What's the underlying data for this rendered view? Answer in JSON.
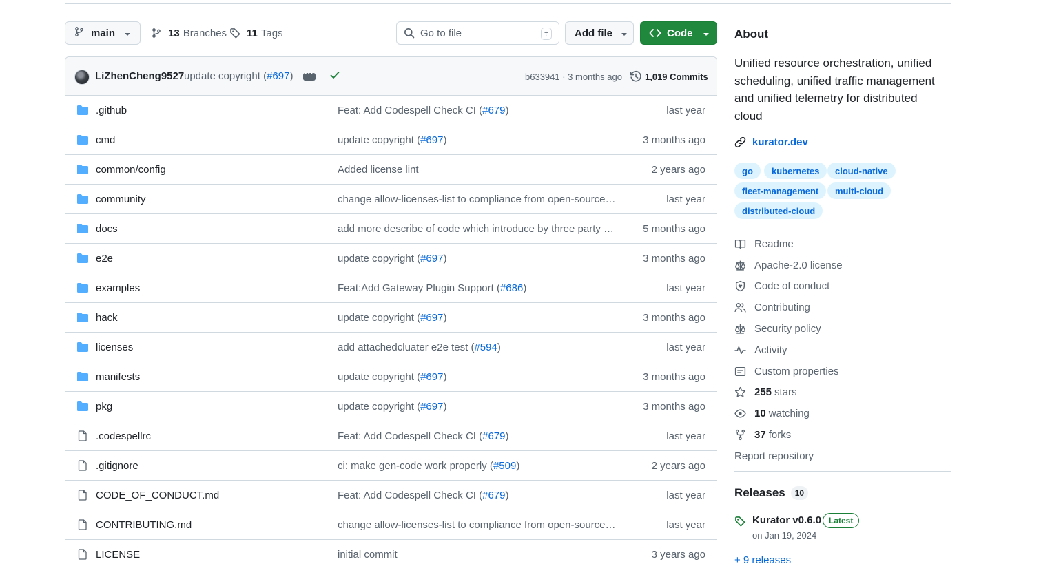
{
  "toolbar": {
    "branch": "main",
    "branches_count": "13",
    "branches_label": "Branches",
    "tags_count": "11",
    "tags_label": "Tags",
    "search_placeholder": "Go to file",
    "search_kbd": "t",
    "add_file": "Add file",
    "code": "Code"
  },
  "commit": {
    "author": "LiZhenCheng9527",
    "message": "update copyright (",
    "pr": "#697",
    "message_end": ")",
    "sha_age": "b633941 · 3 months ago",
    "commits": "1,019 Commits"
  },
  "files": [
    {
      "type": "dir",
      "name": ".github",
      "msg": "Feat: Add Codespell Check CI (",
      "pr": "#679",
      "end": ")",
      "age": "last year"
    },
    {
      "type": "dir",
      "name": "cmd",
      "msg": "update copyright (",
      "pr": "#697",
      "end": ")",
      "age": "3 months ago"
    },
    {
      "type": "dir",
      "name": "common/config",
      "msg": "Added license lint",
      "pr": "",
      "end": "",
      "age": "2 years ago"
    },
    {
      "type": "dir",
      "name": "community",
      "msg": "change allow-licenses-list to compliance from open-source-…",
      "pr": "",
      "end": "",
      "age": "last year"
    },
    {
      "type": "dir",
      "name": "docs",
      "msg": "add more describe of code which introduce by three party o…",
      "pr": "",
      "end": "",
      "age": "5 months ago"
    },
    {
      "type": "dir",
      "name": "e2e",
      "msg": "update copyright (",
      "pr": "#697",
      "end": ")",
      "age": "3 months ago"
    },
    {
      "type": "dir",
      "name": "examples",
      "msg": "Feat:Add Gateway Plugin Support (",
      "pr": "#686",
      "end": ")",
      "age": "last year"
    },
    {
      "type": "dir",
      "name": "hack",
      "msg": "update copyright (",
      "pr": "#697",
      "end": ")",
      "age": "3 months ago"
    },
    {
      "type": "dir",
      "name": "licenses",
      "msg": "add attachedcluater e2e test (",
      "pr": "#594",
      "end": ")",
      "age": "last year"
    },
    {
      "type": "dir",
      "name": "manifests",
      "msg": "update copyright (",
      "pr": "#697",
      "end": ")",
      "age": "3 months ago"
    },
    {
      "type": "dir",
      "name": "pkg",
      "msg": "update copyright (",
      "pr": "#697",
      "end": ")",
      "age": "3 months ago"
    },
    {
      "type": "file",
      "name": ".codespellrc",
      "msg": "Feat: Add Codespell Check CI (",
      "pr": "#679",
      "end": ")",
      "age": "last year"
    },
    {
      "type": "file",
      "name": ".gitignore",
      "msg": "ci: make gen-code work properly (",
      "pr": "#509",
      "end": ")",
      "age": "2 years ago"
    },
    {
      "type": "file",
      "name": "CODE_OF_CONDUCT.md",
      "msg": "Feat: Add Codespell Check CI (",
      "pr": "#679",
      "end": ")",
      "age": "last year"
    },
    {
      "type": "file",
      "name": "CONTRIBUTING.md",
      "msg": "change allow-licenses-list to compliance from open-source-…",
      "pr": "",
      "end": "",
      "age": "last year"
    },
    {
      "type": "file",
      "name": "LICENSE",
      "msg": "initial commit",
      "pr": "",
      "end": "",
      "age": "3 years ago"
    }
  ],
  "about": {
    "heading": "About",
    "description": "Unified resource orchestration, unified scheduling, unified traffic management and unified telemetry for distributed cloud",
    "website": "kurator.dev",
    "topics": [
      "go",
      "kubernetes",
      "cloud-native",
      "fleet-management",
      "multi-cloud",
      "distributed-cloud"
    ],
    "meta": [
      {
        "icon": "book-icon",
        "count": "",
        "label": "Readme"
      },
      {
        "icon": "law-icon",
        "count": "",
        "label": "Apache-2.0 license"
      },
      {
        "icon": "heart-shield-icon",
        "count": "",
        "label": "Code of conduct"
      },
      {
        "icon": "people-icon",
        "count": "",
        "label": "Contributing"
      },
      {
        "icon": "law-icon",
        "count": "",
        "label": "Security policy"
      },
      {
        "icon": "pulse-icon",
        "count": "",
        "label": "Activity"
      },
      {
        "icon": "note-icon",
        "count": "",
        "label": "Custom properties"
      },
      {
        "icon": "star-icon",
        "count": "255",
        "label": "stars"
      },
      {
        "icon": "eye-icon",
        "count": "10",
        "label": "watching"
      },
      {
        "icon": "fork-icon",
        "count": "37",
        "label": "forks"
      },
      {
        "icon": "",
        "count": "",
        "label": "Report repository"
      }
    ]
  },
  "releases": {
    "heading": "Releases",
    "count": "10",
    "latest_name": "Kurator v0.6.0",
    "latest_badge": "Latest",
    "latest_date": "on Jan 19, 2024",
    "more": "+ 9 releases"
  },
  "colors": {
    "accent": "#0969da",
    "primary_button": "#1f883d",
    "folder": "#54aeff",
    "success": "#1a7f37"
  }
}
